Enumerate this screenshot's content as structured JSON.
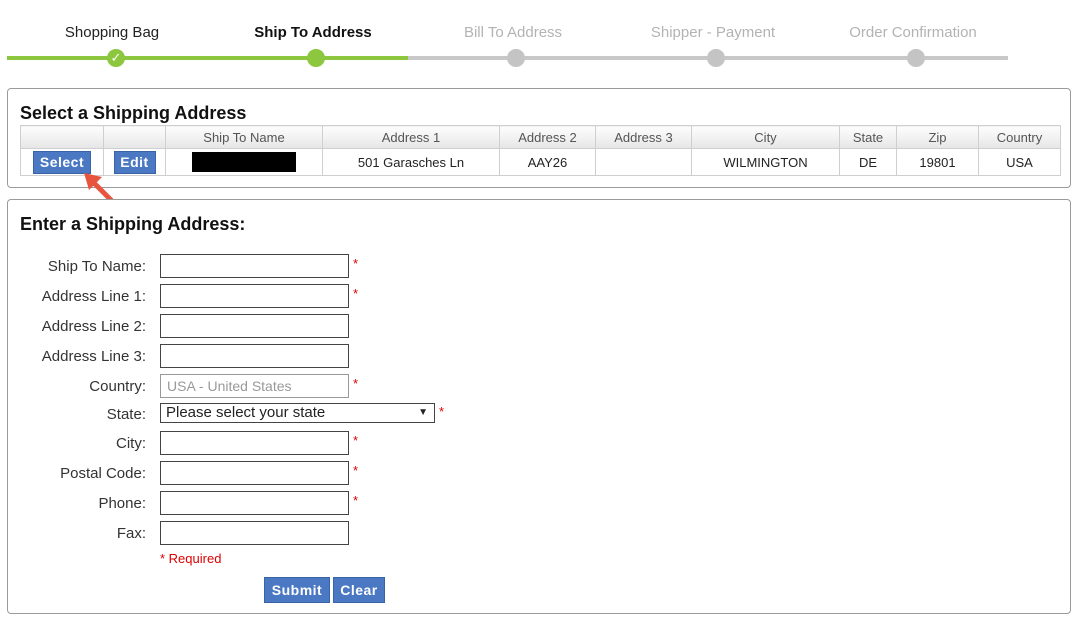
{
  "steps": [
    {
      "label": "Shopping Bag",
      "state": "done"
    },
    {
      "label": "Ship To Address",
      "state": "current"
    },
    {
      "label": "Bill To Address",
      "state": "pending"
    },
    {
      "label": "Shipper - Payment",
      "state": "pending"
    },
    {
      "label": "Order Confirmation",
      "state": "pending"
    }
  ],
  "colors": {
    "done": "#8dc63f",
    "pending": "#c8c8c8",
    "button": "#4a78c2",
    "required": "#dd0000"
  },
  "select_panel": {
    "title": "Select a Shipping Address",
    "columns": [
      "",
      "",
      "Ship To Name",
      "Address 1",
      "Address 2",
      "Address 3",
      "City",
      "State",
      "Zip",
      "Country"
    ],
    "row": {
      "select_label": "Select",
      "edit_label": "Edit",
      "address1": "501 Garasches Ln",
      "address2": "AAY26",
      "address3": "",
      "city": "WILMINGTON",
      "state": "DE",
      "zip": "19801",
      "country": "USA"
    }
  },
  "form": {
    "title": "Enter a Shipping Address:",
    "labels": {
      "ship_to_name": "Ship To Name:",
      "address1": "Address Line 1:",
      "address2": "Address Line 2:",
      "address3": "Address Line 3:",
      "country": "Country:",
      "state": "State:",
      "city": "City:",
      "postal": "Postal Code:",
      "phone": "Phone:",
      "fax": "Fax:"
    },
    "country_value": "USA - United States",
    "state_value": "Please select your state",
    "required_mark": "*",
    "required_note": "* Required",
    "submit_label": "Submit",
    "clear_label": "Clear"
  },
  "icons": {
    "check": "check-icon",
    "caret": "chevron-down-icon",
    "arrow": "pointer-arrow-icon"
  }
}
